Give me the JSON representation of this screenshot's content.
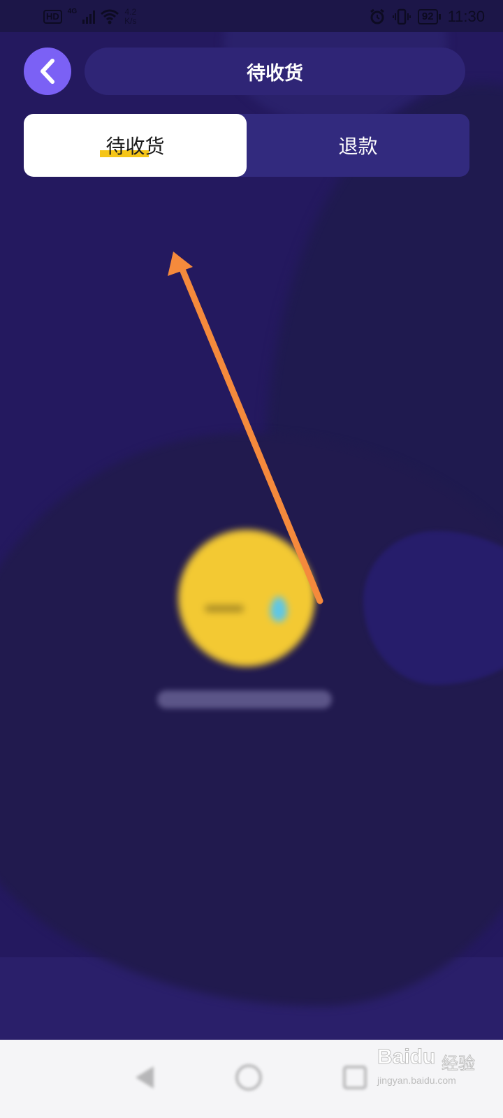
{
  "status_bar": {
    "hd": "HD",
    "network": "4G",
    "speed_value": "4.2",
    "speed_unit": "K/s",
    "battery": "92",
    "time": "11:30"
  },
  "header": {
    "title": "待收货",
    "back_icon": "chevron-left-icon"
  },
  "tabs": [
    {
      "label": "待收货",
      "active": true
    },
    {
      "label": "退款",
      "active": false
    }
  ],
  "colors": {
    "background": "#24195f",
    "accent": "#7b61f5",
    "highlight": "#f5c518",
    "annotation": "#f58a3c"
  },
  "watermark": {
    "logo": "Baidu",
    "suffix": "经验",
    "url": "jingyan.baidu.com"
  }
}
